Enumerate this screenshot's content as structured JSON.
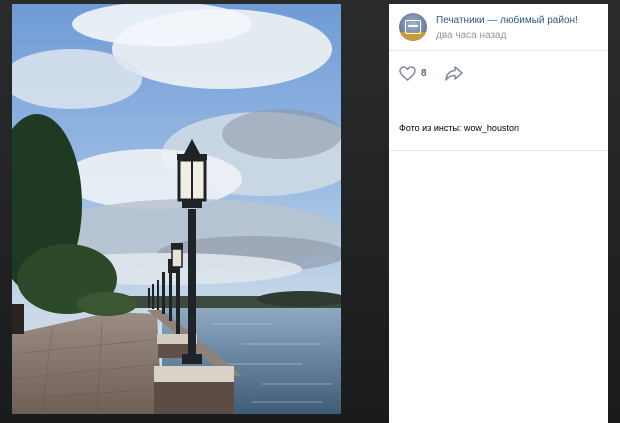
{
  "post": {
    "group_name": "Печатники — любимый район!",
    "time": "два часа назад",
    "likes": "8",
    "caption": "Фото из инсты: wow_houston"
  },
  "icons": {
    "like": "heart-icon",
    "share": "share-arrow-icon",
    "avatar": "group-avatar"
  },
  "colors": {
    "link": "#2a5885",
    "muted": "#939699",
    "icon": "#828a99"
  }
}
